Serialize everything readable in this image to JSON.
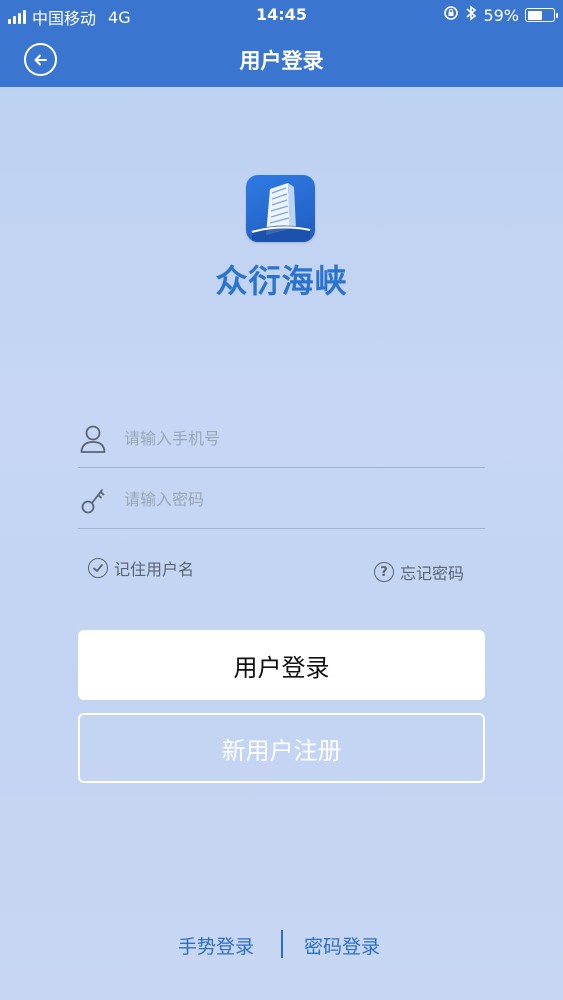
{
  "status_bar": {
    "carrier": "中国移动",
    "network": "4G",
    "time": "14:45",
    "battery": "59%",
    "battery_level": 0.59
  },
  "nav": {
    "title": "用户登录",
    "back_icon": "back-arrow-circle-icon"
  },
  "brand": {
    "name": "众衍海峡",
    "logo_icon": "building-logo-icon",
    "accent_color": "#2c73cf"
  },
  "form": {
    "phone_placeholder": "请输入手机号",
    "phone_value": "",
    "password_placeholder": "请输入密码",
    "password_value": "",
    "remember_label": "记住用户名",
    "forgot_label": "忘记密码"
  },
  "buttons": {
    "login": "用户登录",
    "register": "新用户注册"
  },
  "bottom_links": {
    "gesture_login": "手势登录",
    "password_login": "密码登录"
  },
  "colors": {
    "header": "#3a76cf",
    "link": "#2c6fc9"
  }
}
